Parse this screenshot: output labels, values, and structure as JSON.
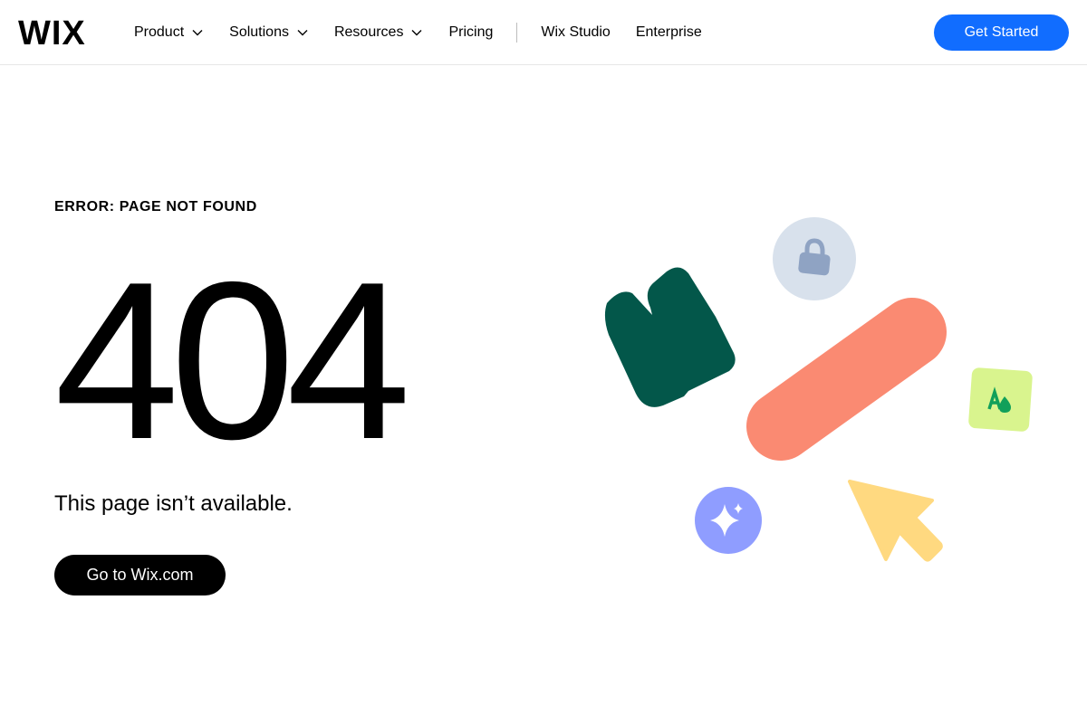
{
  "header": {
    "logo_text": "WIX",
    "nav": {
      "product": "Product",
      "solutions": "Solutions",
      "resources": "Resources",
      "pricing": "Pricing",
      "studio": "Wix Studio",
      "enterprise": "Enterprise"
    },
    "cta_label": "Get Started"
  },
  "main": {
    "eyebrow": "ERROR: PAGE NOT FOUND",
    "code": "404",
    "subtitle": "This page isn’t available.",
    "home_button": "Go to Wix.com"
  },
  "colors": {
    "primary_blue": "#116dff",
    "dark_green": "#03574a",
    "coral": "#fa8a72",
    "lock_circle": "#d8e1ec",
    "lock_icon": "#8fa3c3",
    "lime_tile": "#d9f48e",
    "lime_icon": "#11a05a",
    "purple_circle": "#8f9dff",
    "yellow_cursor": "#ffd980"
  },
  "icons": {
    "lock": "lock-icon",
    "sparkle": "sparkle-icon",
    "font": "font-drop-icon",
    "cursor": "cursor-arrow-icon",
    "shape": "abstract-green-shape-icon"
  }
}
